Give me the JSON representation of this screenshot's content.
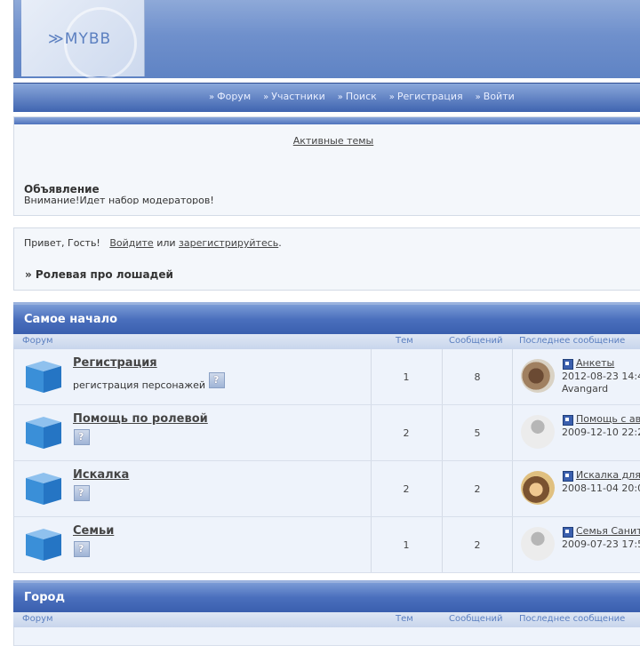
{
  "header": {
    "logo_text": "≫MYBB"
  },
  "menu": [
    {
      "label": "Форум"
    },
    {
      "label": "Участники"
    },
    {
      "label": "Поиск"
    },
    {
      "label": "Регистрация"
    },
    {
      "label": "Войти"
    }
  ],
  "topics_panel": {
    "active_topics_link": "Активные темы",
    "announcement_title": "Объявление",
    "announcement_text": "Внимание!Идет набор модераторов!"
  },
  "welcome": {
    "greeting": "Привет, Гость!",
    "login_link": "Войдите",
    "or": "или",
    "register_link": "зарегистрируйтесь",
    "period": ".",
    "breadcrumb": "» Ролевая про лошадей"
  },
  "columns": {
    "forum": "Форум",
    "topics": "Тем",
    "posts": "Сообщений",
    "last": "Последнее сообщение"
  },
  "categories": [
    {
      "title": "Самое начало",
      "forums": [
        {
          "name": "Регистрация",
          "desc": "регистрация персонажей",
          "topics": "1",
          "posts": "8",
          "last_title": "Анкеты",
          "last_date": "2012-08-23 14:4",
          "last_user": "Avangard"
        },
        {
          "name": "Помощь по ролевой",
          "desc": "",
          "topics": "2",
          "posts": "5",
          "last_title": "Помощь с ав",
          "last_date": "2009-12-10 22:2",
          "last_user": ""
        },
        {
          "name": "Искалка",
          "desc": "",
          "topics": "2",
          "posts": "2",
          "last_title": "Искалка для",
          "last_date": "2008-11-04 20:0",
          "last_user": ""
        },
        {
          "name": "Семьи",
          "desc": "",
          "topics": "1",
          "posts": "2",
          "last_title": "Семья Санит",
          "last_date": "2009-07-23 17:5",
          "last_user": ""
        }
      ]
    },
    {
      "title": "Город",
      "forums": []
    }
  ]
}
